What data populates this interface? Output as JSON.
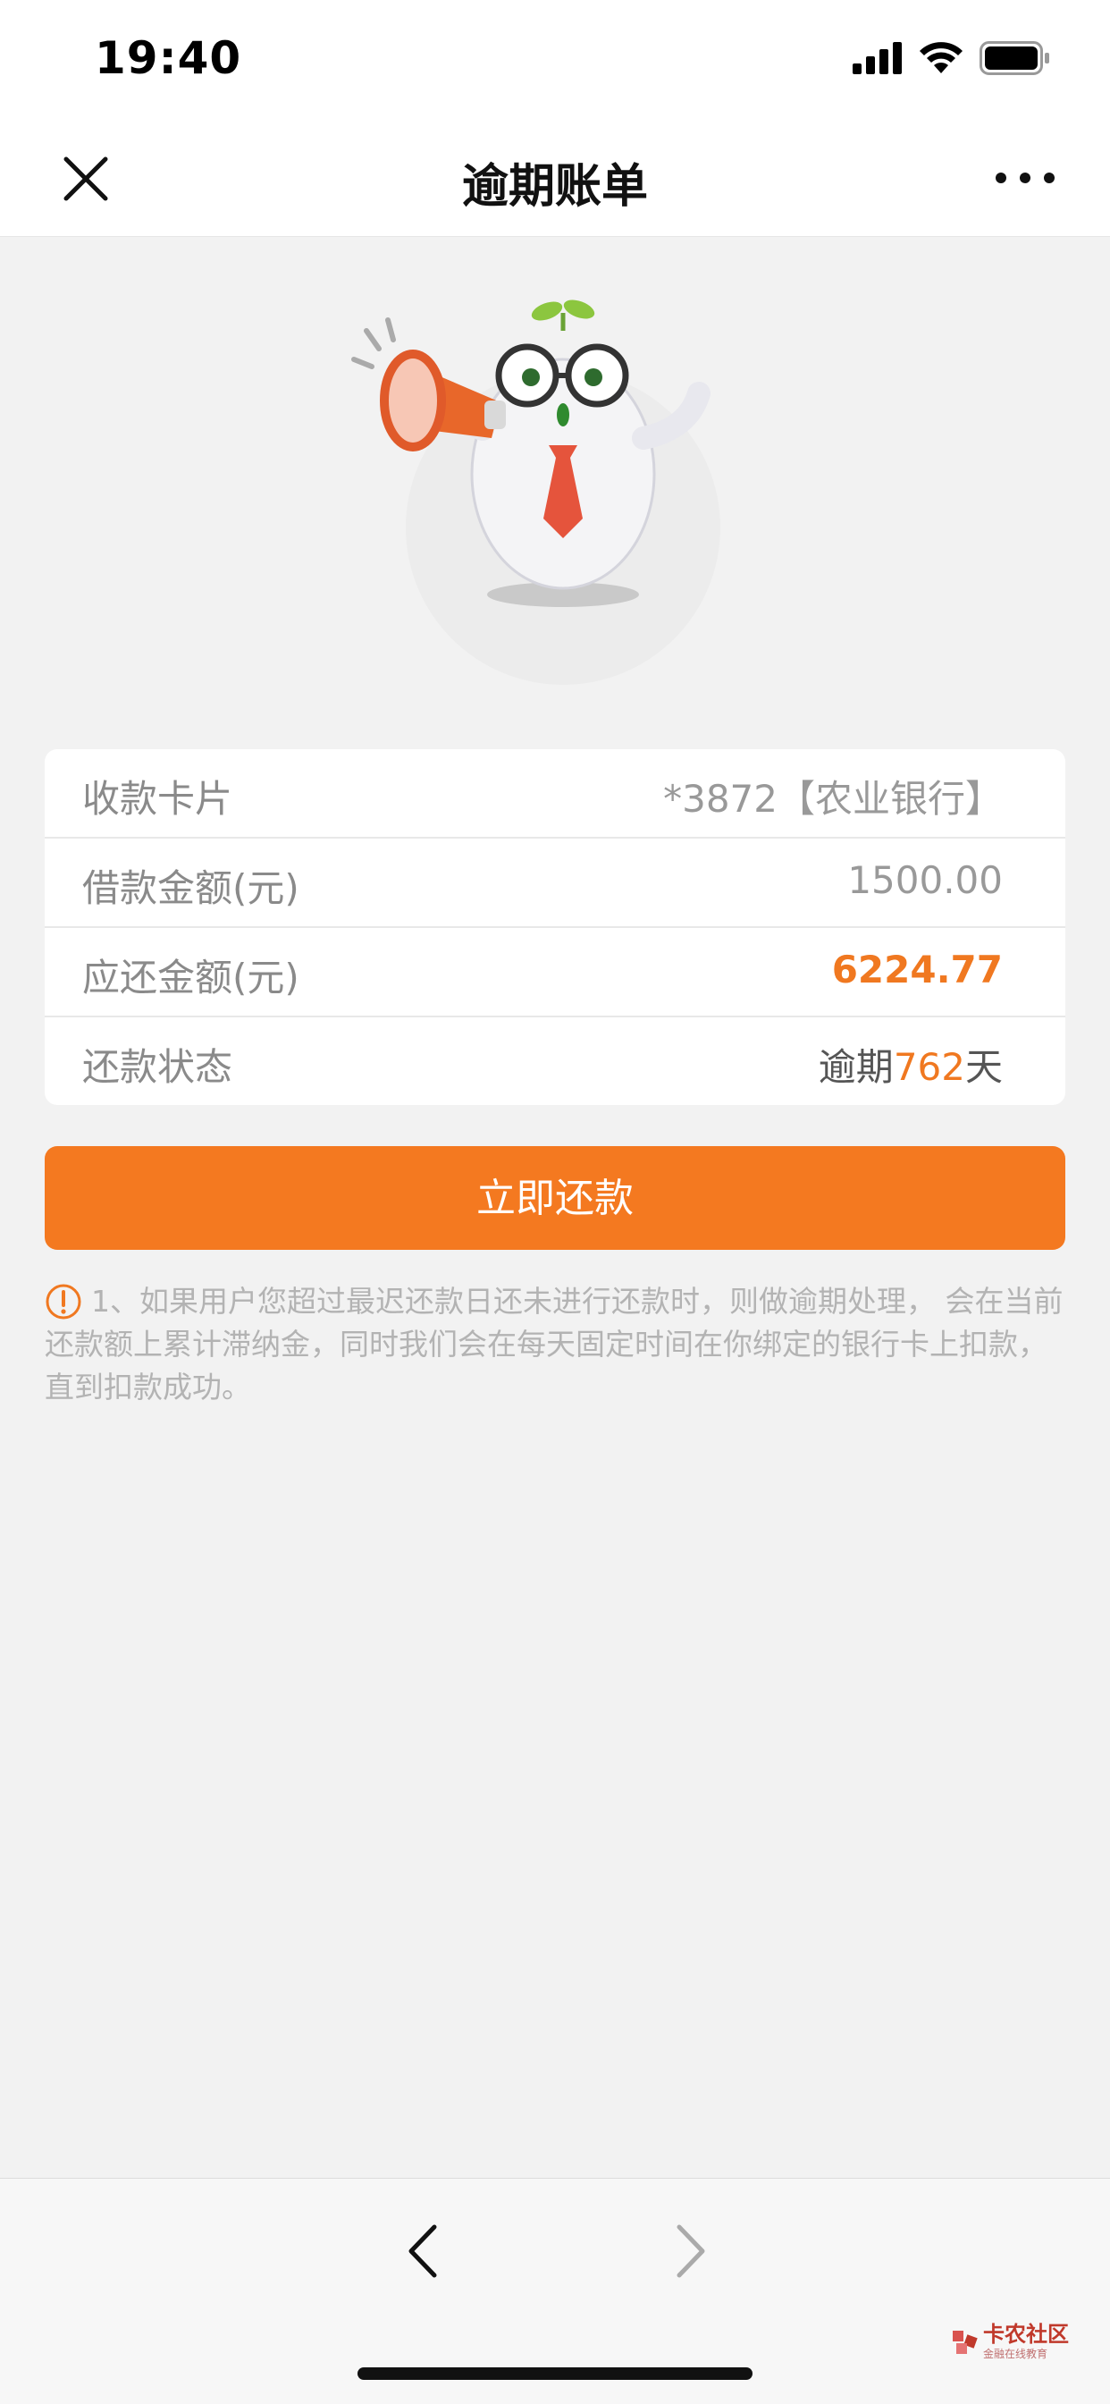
{
  "status_bar": {
    "time": "19:40"
  },
  "nav": {
    "title": "逾期账单"
  },
  "bill": {
    "rows": [
      {
        "label": "收款卡片",
        "value": "*3872【农业银行】"
      },
      {
        "label": "借款金额(元)",
        "value": "1500.00"
      },
      {
        "label": "应还金额(元)",
        "value": "6224.77"
      },
      {
        "label": "还款状态",
        "value_prefix": "逾期",
        "value_number": "762",
        "value_suffix": "天"
      }
    ]
  },
  "pay_button": {
    "label": "立即还款"
  },
  "notice": {
    "text": "1、如果用户您超过最迟还款日还未进行还款时，则做逾期处理， 会在当前还款额上累计滞纳金，同时我们会在每天固定时间在你绑定的银行卡上扣款，直到扣款成功。"
  },
  "watermark": {
    "text": "卡农社区",
    "sub": "金融在线教育"
  },
  "colors": {
    "accent": "#f47920",
    "amount": "#f07820",
    "background": "#f2f2f2"
  },
  "icons": [
    "signal-icon",
    "wifi-icon",
    "battery-icon",
    "close-icon",
    "more-icon",
    "warning-icon",
    "back-arrow-icon",
    "forward-arrow-icon"
  ]
}
